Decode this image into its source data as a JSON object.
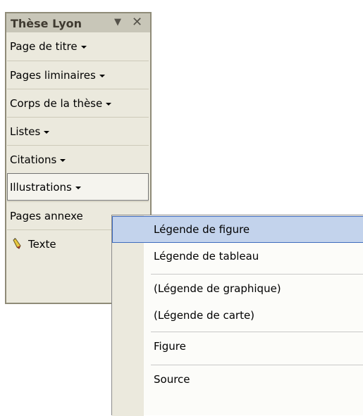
{
  "toolbar": {
    "title": "Thèse Lyon",
    "dropdown_icon": "▼",
    "close_icon": "✕",
    "items": [
      {
        "label": "Page de titre"
      },
      {
        "label": "Pages liminaires"
      },
      {
        "label": "Corps de la thèse"
      },
      {
        "label": "Listes"
      },
      {
        "label": "Citations"
      },
      {
        "label": "Illustrations"
      },
      {
        "label": "Pages annexe"
      },
      {
        "label": "Texte",
        "icon": "pencil-icon"
      }
    ]
  },
  "menu": {
    "items": [
      {
        "label": "Légende de figure"
      },
      {
        "label": "Légende de tableau"
      },
      {
        "label": "(Légende de graphique)"
      },
      {
        "label": "(Légende de carte)"
      },
      {
        "label": "Figure"
      },
      {
        "label": "Source"
      }
    ]
  },
  "colors": {
    "toolbar_bg": "#ebe9dd",
    "title_bg": "#c8c6b8",
    "highlight": "#c3d3ec",
    "highlight_border": "#3e6bbd"
  }
}
